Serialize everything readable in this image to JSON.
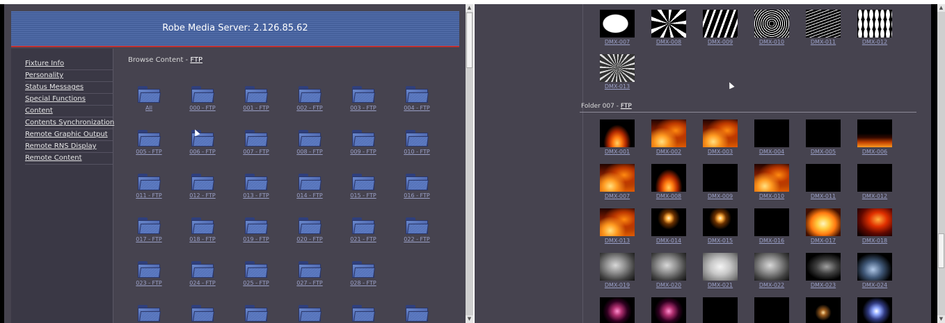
{
  "left": {
    "header_title": "Robe Media Server: 2.126.85.62",
    "sidebar": [
      {
        "label": "Fixture Info"
      },
      {
        "label": "Personality"
      },
      {
        "label": "Status Messages"
      },
      {
        "label": "Special Functions"
      },
      {
        "label": "Content"
      },
      {
        "label": "Contents Synchronization"
      },
      {
        "label": "Remote Graphic Output"
      },
      {
        "label": "Remote RNS Display"
      },
      {
        "label": "Remote Content"
      }
    ],
    "browse_prefix": "Browse Content - ",
    "browse_link": "FTP",
    "folders": [
      {
        "name": "All",
        "suffix": ""
      },
      {
        "name": "000 - ",
        "suffix": "FTP"
      },
      {
        "name": "001 - ",
        "suffix": "FTP"
      },
      {
        "name": "002 - ",
        "suffix": "FTP"
      },
      {
        "name": "003 - ",
        "suffix": "FTP"
      },
      {
        "name": "004 - ",
        "suffix": "FTP"
      },
      {
        "name": "005 - ",
        "suffix": "FTP"
      },
      {
        "name": "006 - ",
        "suffix": "FTP"
      },
      {
        "name": "007 - ",
        "suffix": "FTP"
      },
      {
        "name": "008 - ",
        "suffix": "FTP"
      },
      {
        "name": "009 - ",
        "suffix": "FTP"
      },
      {
        "name": "010 - ",
        "suffix": "FTP"
      },
      {
        "name": "011 - ",
        "suffix": "FTP"
      },
      {
        "name": "012 - ",
        "suffix": "FTP"
      },
      {
        "name": "013 - ",
        "suffix": "FTP"
      },
      {
        "name": "014 - ",
        "suffix": "FTP"
      },
      {
        "name": "015 - ",
        "suffix": "FTP"
      },
      {
        "name": "016 - ",
        "suffix": "FTP"
      },
      {
        "name": "017 - ",
        "suffix": "FTP"
      },
      {
        "name": "018 - ",
        "suffix": "FTP"
      },
      {
        "name": "019 - ",
        "suffix": "FTP"
      },
      {
        "name": "020 - ",
        "suffix": "FTP"
      },
      {
        "name": "021 - ",
        "suffix": "FTP"
      },
      {
        "name": "022 - ",
        "suffix": "FTP"
      },
      {
        "name": "023 - ",
        "suffix": "FTP"
      },
      {
        "name": "024 - ",
        "suffix": "FTP"
      },
      {
        "name": "025 - ",
        "suffix": "FTP"
      },
      {
        "name": "027 - ",
        "suffix": "FTP"
      },
      {
        "name": "028 - ",
        "suffix": "FTP"
      }
    ]
  },
  "right": {
    "top_items": [
      {
        "label": "DMX-007",
        "style": "gobo-white"
      },
      {
        "label": "DMX-008",
        "style": "gobo-swirl"
      },
      {
        "label": "DMX-009",
        "style": "gobo-wave"
      },
      {
        "label": "DMX-010",
        "style": "gobo-tangle"
      },
      {
        "label": "DMX-011",
        "style": "gobo-streaks"
      },
      {
        "label": "DMX-012",
        "style": "gobo-dots"
      },
      {
        "label": "DMX-013",
        "style": "gobo-star"
      }
    ],
    "folder_prefix": "Folder 007 - ",
    "folder_link": "FTP",
    "items": [
      {
        "label": "DMX-001",
        "style": "fire-small"
      },
      {
        "label": "DMX-002",
        "style": "fire-big"
      },
      {
        "label": "DMX-003",
        "style": "fire-big"
      },
      {
        "label": "DMX-004",
        "style": "black"
      },
      {
        "label": "DMX-005",
        "style": "black"
      },
      {
        "label": "DMX-006",
        "style": "fire-low"
      },
      {
        "label": "DMX-007",
        "style": "fire-big"
      },
      {
        "label": "DMX-008",
        "style": "fire-small"
      },
      {
        "label": "DMX-009",
        "style": "black"
      },
      {
        "label": "DMX-010",
        "style": "fire-big"
      },
      {
        "label": "DMX-011",
        "style": "black"
      },
      {
        "label": "DMX-012",
        "style": "black"
      },
      {
        "label": "DMX-013",
        "style": "fire-big"
      },
      {
        "label": "DMX-014",
        "style": "candle"
      },
      {
        "label": "DMX-015",
        "style": "candle"
      },
      {
        "label": "DMX-016",
        "style": "black"
      },
      {
        "label": "DMX-017",
        "style": "fire-bright"
      },
      {
        "label": "DMX-018",
        "style": "fire-red"
      },
      {
        "label": "DMX-019",
        "style": "smoke"
      },
      {
        "label": "DMX-020",
        "style": "smoke"
      },
      {
        "label": "DMX-021",
        "style": "smoke-light"
      },
      {
        "label": "DMX-022",
        "style": "smoke"
      },
      {
        "label": "DMX-023",
        "style": "smoke-dark"
      },
      {
        "label": "DMX-024",
        "style": "smoke-blue"
      },
      {
        "label": "",
        "style": "sparks-pink"
      },
      {
        "label": "",
        "style": "sparks-pink"
      },
      {
        "label": "",
        "style": "black"
      },
      {
        "label": "",
        "style": "black"
      },
      {
        "label": "",
        "style": "sparks-gold"
      },
      {
        "label": "",
        "style": "sparks-blue"
      }
    ]
  }
}
